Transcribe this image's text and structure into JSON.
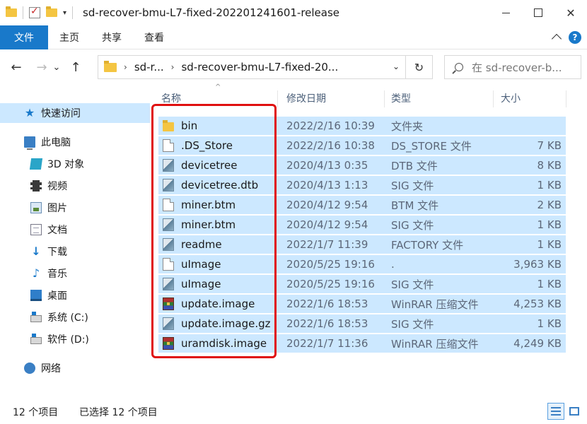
{
  "window": {
    "title": "sd-recover-bmu-L7-fixed-202201241601-release",
    "minimize_icon": "minimize-icon",
    "maximize_icon": "maximize-icon",
    "close_glyph": "✕"
  },
  "ribbon": {
    "tabs": [
      {
        "label": "文件",
        "active": true
      },
      {
        "label": "主页",
        "active": false
      },
      {
        "label": "共享",
        "active": false
      },
      {
        "label": "查看",
        "active": false
      }
    ],
    "help_glyph": "?"
  },
  "nav": {
    "back_glyph": "←",
    "forward_glyph": "→",
    "recent_glyph": "⌄",
    "up_glyph": "↑",
    "breadcrumb": [
      "sd-r...",
      "sd-recover-bmu-L7-fixed-20..."
    ],
    "crumb_sep": "›",
    "dropdown_glyph": "⌄",
    "refresh_glyph": "↻",
    "search_placeholder": "在 sd-recover-b..."
  },
  "sidebar": {
    "items": [
      {
        "label": "快速访问",
        "icon": "star-icon",
        "selected": true
      },
      {
        "label": "此电脑",
        "icon": "pc-icon"
      },
      {
        "label": "3D 对象",
        "icon": "3d-objects-icon"
      },
      {
        "label": "视频",
        "icon": "video-icon"
      },
      {
        "label": "图片",
        "icon": "pictures-icon"
      },
      {
        "label": "文档",
        "icon": "documents-icon"
      },
      {
        "label": "下载",
        "icon": "download-icon"
      },
      {
        "label": "音乐",
        "icon": "music-icon"
      },
      {
        "label": "桌面",
        "icon": "desktop-icon"
      },
      {
        "label": "系统 (C:)",
        "icon": "drive-icon"
      },
      {
        "label": "软件 (D:)",
        "icon": "drive-icon"
      },
      {
        "label": "网络",
        "icon": "network-icon"
      }
    ]
  },
  "columns": {
    "name": "名称",
    "date": "修改日期",
    "type": "类型",
    "size": "大小"
  },
  "files": [
    {
      "name": "bin",
      "date": "2022/2/16 10:39",
      "type": "文件夹",
      "size": "",
      "icon": "folder-icon"
    },
    {
      "name": ".DS_Store",
      "date": "2022/2/16 10:38",
      "type": "DS_STORE 文件",
      "size": "7 KB",
      "icon": "blank-file-icon"
    },
    {
      "name": "devicetree",
      "date": "2020/4/13 0:35",
      "type": "DTB 文件",
      "size": "8 KB",
      "icon": "sig-file-icon"
    },
    {
      "name": "devicetree.dtb",
      "date": "2020/4/13 1:13",
      "type": "SIG 文件",
      "size": "1 KB",
      "icon": "sig-file-icon"
    },
    {
      "name": "miner.btm",
      "date": "2020/4/12 9:54",
      "type": "BTM 文件",
      "size": "2 KB",
      "icon": "blank-file-icon"
    },
    {
      "name": "miner.btm",
      "date": "2020/4/12 9:54",
      "type": "SIG 文件",
      "size": "1 KB",
      "icon": "sig-file-icon"
    },
    {
      "name": "readme",
      "date": "2022/1/7 11:39",
      "type": "FACTORY 文件",
      "size": "1 KB",
      "icon": "sig-file-icon"
    },
    {
      "name": "uImage",
      "date": "2020/5/25 19:16",
      "type": ".",
      "size": "3,963 KB",
      "icon": "blank-file-icon"
    },
    {
      "name": "uImage",
      "date": "2020/5/25 19:16",
      "type": "SIG 文件",
      "size": "1 KB",
      "icon": "sig-file-icon"
    },
    {
      "name": "update.image",
      "date": "2022/1/6 18:53",
      "type": "WinRAR 压缩文件",
      "size": "4,253 KB",
      "icon": "winrar-icon"
    },
    {
      "name": "update.image.gz",
      "date": "2022/1/6 18:53",
      "type": "SIG 文件",
      "size": "1 KB",
      "icon": "sig-file-icon"
    },
    {
      "name": "uramdisk.image",
      "date": "2022/1/7 11:36",
      "type": "WinRAR 压缩文件",
      "size": "4,249 KB",
      "icon": "winrar-icon"
    }
  ],
  "status": {
    "count": "12 个项目",
    "selected": "已选择 12 个项目"
  },
  "colors": {
    "accent": "#1979ca",
    "selection": "#cce8ff",
    "highlight_border": "#e01010"
  }
}
